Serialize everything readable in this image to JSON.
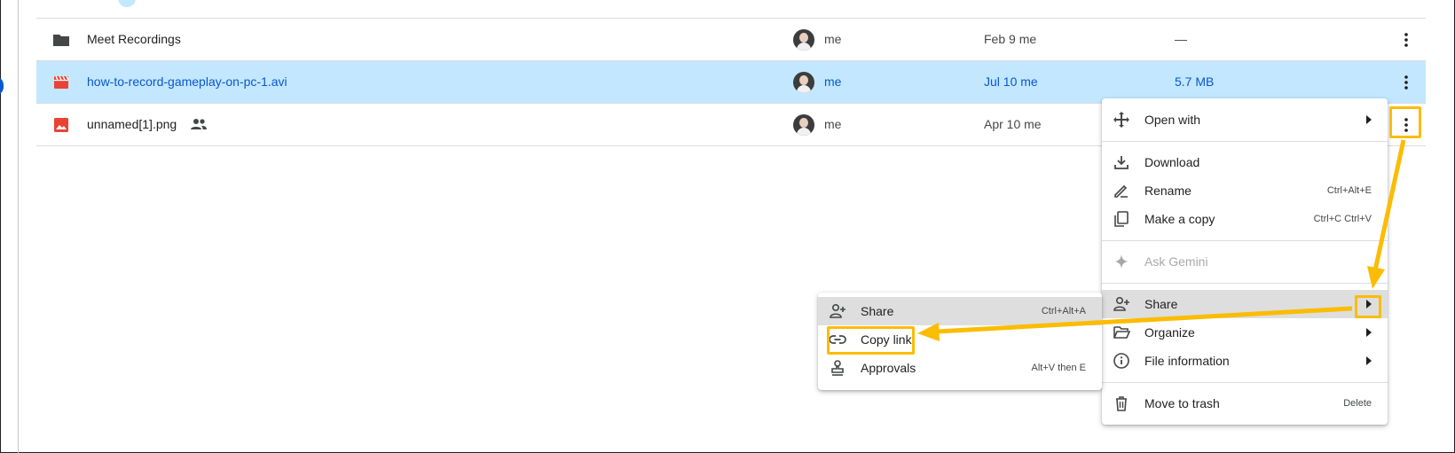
{
  "files": [
    {
      "name": "Meet Recordings",
      "type": "folder",
      "shared": false,
      "owner": "me",
      "modified": "Feb 9 me",
      "size": "—",
      "selected": false
    },
    {
      "name": "how-to-record-gameplay-on-pc-1.avi",
      "type": "video",
      "shared": false,
      "owner": "me",
      "modified": "Jul 10 me",
      "size": "5.7 MB",
      "selected": true
    },
    {
      "name": "unnamed[1].png",
      "type": "image",
      "shared": true,
      "owner": "me",
      "modified": "Apr 10 me",
      "size": "",
      "selected": false
    }
  ],
  "context_menu": {
    "items": [
      {
        "label": "Open with",
        "icon": "open-with-icon",
        "submenu": true
      },
      {
        "label": "Download",
        "icon": "download-icon"
      },
      {
        "label": "Rename",
        "icon": "rename-icon",
        "shortcut": "Ctrl+Alt+E"
      },
      {
        "label": "Make a copy",
        "icon": "copy-icon",
        "shortcut": "Ctrl+C Ctrl+V"
      },
      {
        "label": "Ask Gemini",
        "icon": "gemini-sparkle-icon",
        "disabled": true
      },
      {
        "label": "Share",
        "icon": "person-add-icon",
        "submenu": true,
        "active": true
      },
      {
        "label": "Organize",
        "icon": "folder-open-icon",
        "submenu": true
      },
      {
        "label": "File information",
        "icon": "info-icon",
        "submenu": true
      },
      {
        "label": "Move to trash",
        "icon": "trash-icon",
        "shortcut": "Delete"
      }
    ]
  },
  "share_submenu": {
    "items": [
      {
        "label": "Share",
        "icon": "person-add-icon",
        "shortcut": "Ctrl+Alt+A",
        "active": true
      },
      {
        "label": "Copy link",
        "icon": "link-icon"
      },
      {
        "label": "Approvals",
        "icon": "approvals-stamp-icon",
        "shortcut": "Alt+V then E"
      }
    ]
  },
  "colors": {
    "selected_row": "#c2e7ff",
    "selected_text": "#0b57d0",
    "annotation": "#fbbc04",
    "video_icon": "#ea4335",
    "image_icon": "#ea4335",
    "folder_icon": "#444746"
  }
}
